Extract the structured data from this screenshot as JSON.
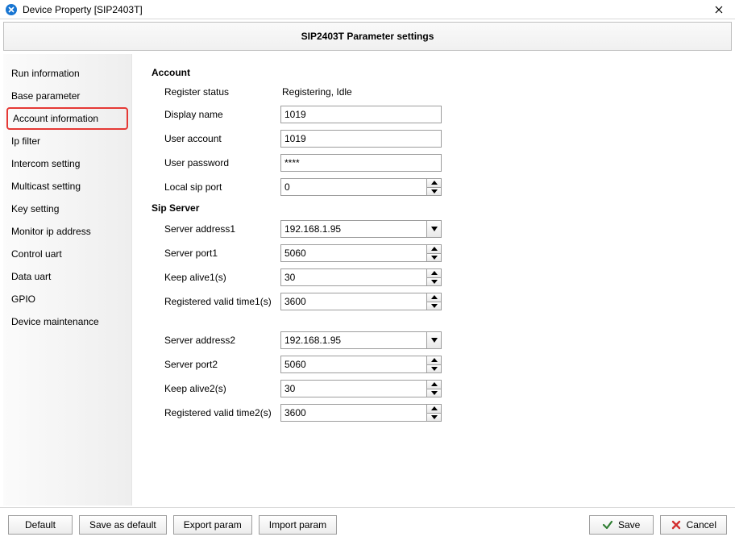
{
  "titlebar": {
    "title": "Device Property [SIP2403T]"
  },
  "header": {
    "title": "SIP2403T Parameter settings"
  },
  "sidebar": {
    "active_index": 2,
    "items": [
      {
        "label": "Run information"
      },
      {
        "label": "Base parameter"
      },
      {
        "label": "Account information"
      },
      {
        "label": "Ip filter"
      },
      {
        "label": "Intercom setting"
      },
      {
        "label": "Multicast setting"
      },
      {
        "label": "Key setting"
      },
      {
        "label": "Monitor ip address"
      },
      {
        "label": "Control uart"
      },
      {
        "label": "Data uart"
      },
      {
        "label": "GPIO"
      },
      {
        "label": "Device maintenance"
      }
    ]
  },
  "account": {
    "section_title": "Account",
    "register_status_label": "Register status",
    "register_status_value": "Registering, Idle",
    "display_name_label": "Display name",
    "display_name_value": "1019",
    "user_account_label": "User account",
    "user_account_value": "1019",
    "user_password_label": "User password",
    "user_password_value": "****",
    "local_sip_port_label": "Local sip port",
    "local_sip_port_value": "0"
  },
  "sip": {
    "section_title": "Sip Server",
    "server_address1_label": "Server address1",
    "server_address1_value": "192.168.1.95",
    "server_port1_label": "Server port1",
    "server_port1_value": "5060",
    "keepalive1_label": "Keep alive1(s)",
    "keepalive1_value": "30",
    "regvalid1_label": "Registered valid time1(s)",
    "regvalid1_value": "3600",
    "server_address2_label": "Server address2",
    "server_address2_value": "192.168.1.95",
    "server_port2_label": "Server port2",
    "server_port2_value": "5060",
    "keepalive2_label": "Keep alive2(s)",
    "keepalive2_value": "30",
    "regvalid2_label": "Registered valid time2(s)",
    "regvalid2_value": "3600"
  },
  "buttons": {
    "default": "Default",
    "save_as_default": "Save as default",
    "export_param": "Export param",
    "import_param": "Import param",
    "save": "Save",
    "cancel": "Cancel"
  },
  "icons": {
    "check_color": "#2e7d32",
    "x_color": "#d32f2f"
  }
}
